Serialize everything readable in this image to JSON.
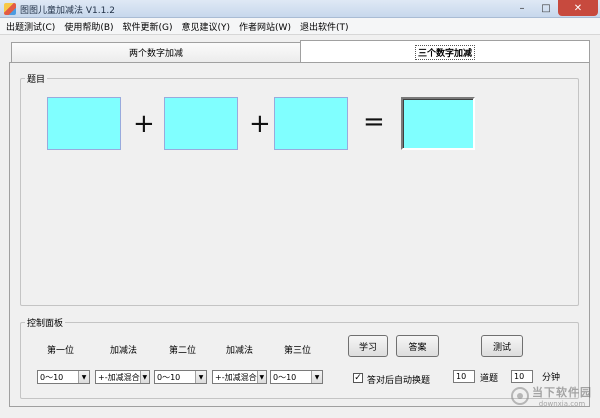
{
  "window": {
    "title": "图图儿童加减法 V1.1.2",
    "app_icon": "app-logo-icon"
  },
  "menu": [
    "出题测试(C)",
    "使用帮助(B)",
    "软件更新(G)",
    "意见建议(Y)",
    "作者网站(W)",
    "退出软件(T)"
  ],
  "tabs": {
    "tab1": "两个数字加减",
    "tab2": "三个数字加减",
    "active": "tab2"
  },
  "question": {
    "legend": "题目",
    "op1": "+",
    "op2": "+",
    "equals": "=",
    "box_color": "#80ffff"
  },
  "control": {
    "legend": "控制面板",
    "labels": {
      "first": "第一位",
      "op_a": "加减法",
      "second": "第二位",
      "op_b": "加减法",
      "third": "第三位"
    },
    "combos": {
      "first": "0～10",
      "op_a": "+-加减混合",
      "second": "0～10",
      "op_b": "+-加减混合",
      "third": "0～10"
    },
    "buttons": {
      "learn": "学习",
      "answer": "答案",
      "test": "测试"
    },
    "auto_next": {
      "label": "答对后自动换题",
      "checked": "✓"
    },
    "question_count": {
      "value": "10",
      "unit": "道题"
    },
    "minutes": {
      "value": "10",
      "unit": "分钟"
    }
  },
  "watermark": {
    "main": "当下软件园",
    "sub": "downxia.com"
  }
}
